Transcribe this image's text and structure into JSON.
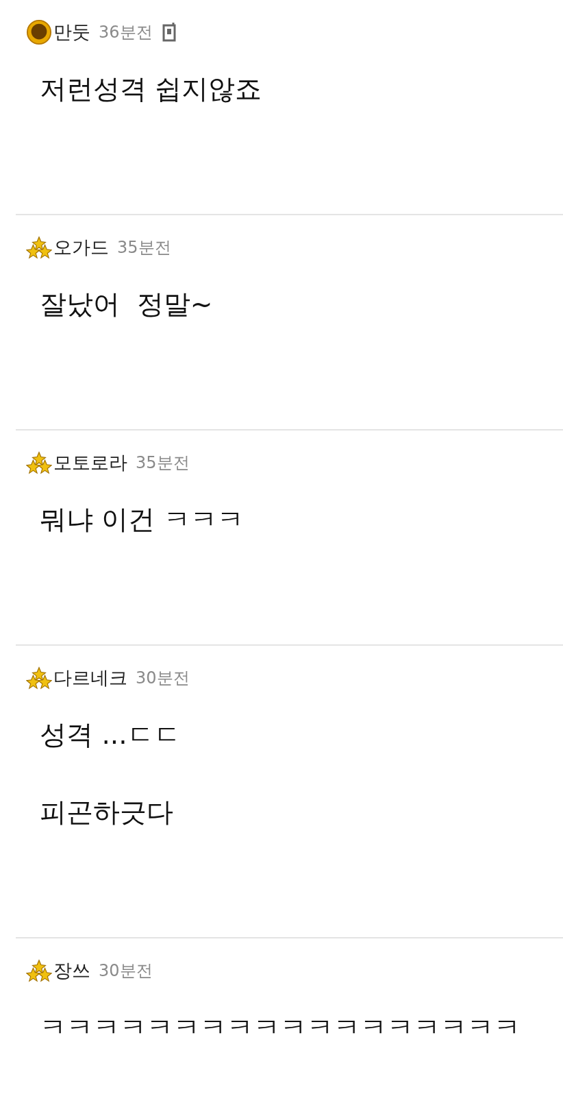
{
  "comments": [
    {
      "author": "만둣",
      "time": "36분전",
      "kind": "sun",
      "mobile": true,
      "paragraphs": [
        "저런성격 쉽지않죠"
      ]
    },
    {
      "author": "오가드",
      "time": "35분전",
      "kind": "stars",
      "mobile": false,
      "paragraphs": [
        "잘났어  정말~"
      ]
    },
    {
      "author": "모토로라",
      "time": "35분전",
      "kind": "stars",
      "mobile": false,
      "paragraphs": [
        "뭐냐 이건 ㅋㅋㅋ"
      ]
    },
    {
      "author": "다르네크",
      "time": "30분전",
      "kind": "stars",
      "mobile": false,
      "paragraphs": [
        "성격 ...ㄷㄷ",
        "피곤하긋다"
      ]
    },
    {
      "author": "장쓰",
      "time": "30분전",
      "kind": "stars",
      "mobile": false,
      "paragraphs": [
        "ㅋㅋㅋㅋㅋㅋㅋㅋㅋㅋㅋㅋㅋㅋㅋㅋㅋㅋ"
      ]
    }
  ]
}
